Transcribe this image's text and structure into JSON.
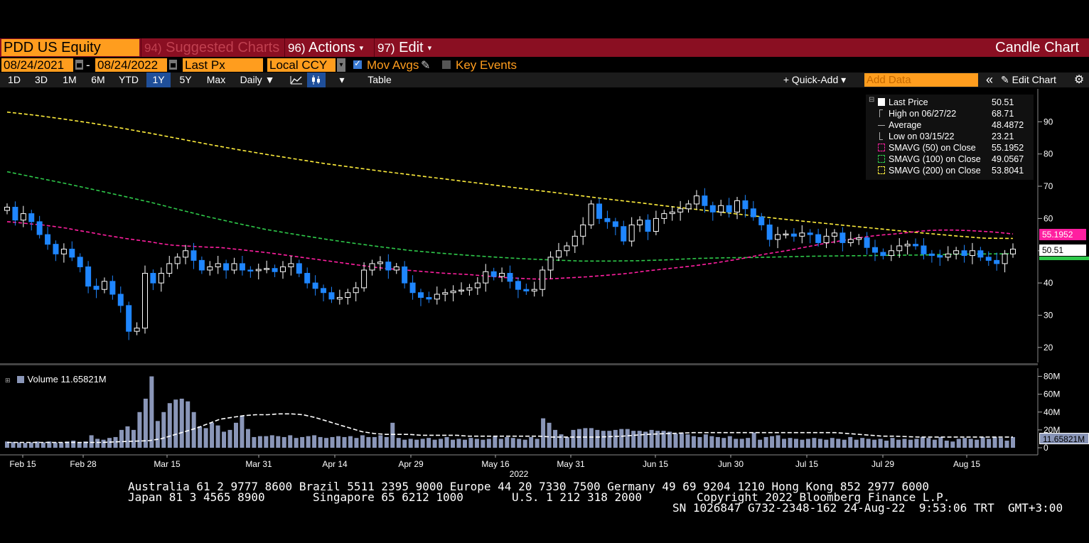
{
  "header": {
    "ticker": "PDD US Equity",
    "suggested": {
      "num": "94)",
      "label": "Suggested Charts"
    },
    "actions": {
      "num": "96)",
      "label": "Actions"
    },
    "edit": {
      "num": "97)",
      "label": "Edit"
    },
    "chart_title": "Candle Chart",
    "caret": "▾"
  },
  "controls": {
    "start_date": "08/24/2021",
    "date_sep": "-",
    "end_date": "08/24/2022",
    "field": "Last Px",
    "currency": "Local CCY",
    "mov_avgs_label": "Mov Avgs",
    "mov_avgs_checked": true,
    "key_events_label": "Key Events",
    "key_events_checked": false
  },
  "toolbar": {
    "ranges": [
      "1D",
      "3D",
      "1M",
      "6M",
      "YTD",
      "1Y",
      "5Y",
      "Max"
    ],
    "active_range": "1Y",
    "period": "Daily ▼",
    "table_label": "Table",
    "quick_add_label": "+ Quick-Add ▾",
    "add_data_placeholder": "Add Data",
    "edit_chart_label": "Edit Chart",
    "collapse_glyph": "«",
    "pencil_glyph": "✎",
    "gear_glyph": "⚙"
  },
  "legend": {
    "rows": [
      {
        "label": "Last Price",
        "value": "50.51",
        "marker": "white-square"
      },
      {
        "label": "High on 06/27/22",
        "value": "68.71",
        "marker": "high-tick"
      },
      {
        "label": "Average",
        "value": "48.4872",
        "marker": "avg-line"
      },
      {
        "label": "Low on 03/15/22",
        "value": "23.21",
        "marker": "low-tick"
      },
      {
        "label": "SMAVG (50)  on Close",
        "value": "55.1952",
        "marker": "pink-dash"
      },
      {
        "label": "SMAVG (100)  on Close",
        "value": "49.0567",
        "marker": "green-dash"
      },
      {
        "label": "SMAVG (200)  on Close",
        "value": "53.8041",
        "marker": "yellow-dash"
      }
    ]
  },
  "volume_legend": {
    "label": "Volume",
    "value": "11.65821M"
  },
  "price_tags": {
    "sma50": "55.1952",
    "last": "50.51",
    "vol": "11.65821M"
  },
  "footer": {
    "line1": "Australia 61 2 9777 8600 Brazil 5511 2395 9000 Europe 44 20 7330 7500 Germany 49 69 9204 1210 Hong Kong 852 2977 6000",
    "line2a": "Japan 81 3 4565 8900",
    "line2b": "Singapore 65 6212 1000",
    "line2c": "U.S. 1 212 318 2000",
    "line2d": "Copyright 2022 Bloomberg Finance L.P.",
    "line3": "SN 1026847 G732-2348-162 24-Aug-22  9:53:06 TRT  GMT+3:00"
  },
  "colors": {
    "up": "#ffffff",
    "down": "#1f86ff",
    "sma50": "#ff1fa0",
    "sma100": "#2ec94a",
    "sma200": "#ffee3c",
    "volume": "#8a96b8",
    "header_red": "#8a0f22",
    "accent_orange": "#ff9d1e"
  },
  "chart_data": {
    "type": "candlestick",
    "x_tick_labels": [
      "Feb 15",
      "Feb 28",
      "Mar 15",
      "Mar 31",
      "Apr 14",
      "Apr 29",
      "May 16",
      "May 31",
      "Jun 15",
      "Jun 30",
      "Jul 15",
      "Jul 29",
      "Aug 15"
    ],
    "x_year_label": "2022",
    "y_ticks": [
      20,
      30,
      40,
      50,
      60,
      70,
      80,
      90
    ],
    "ylim": [
      16,
      98
    ],
    "vol_ticks": [
      {
        "label": "0",
        "v": 0
      },
      {
        "label": "20M",
        "v": 20
      },
      {
        "label": "40M",
        "v": 40
      },
      {
        "label": "60M",
        "v": 60
      },
      {
        "label": "80M",
        "v": 80
      }
    ],
    "vol_ylim": [
      0,
      90
    ],
    "close": [
      63.5,
      59.5,
      61.5,
      59,
      55,
      52,
      49,
      50.5,
      48,
      45,
      39,
      38,
      40.5,
      36.5,
      33,
      25,
      26,
      43,
      40,
      43,
      46,
      48,
      50,
      47,
      44,
      45,
      46,
      44,
      46,
      44,
      43.8,
      44.2,
      44.5,
      43.5,
      45,
      46,
      43,
      40,
      38.3,
      37,
      35,
      35.5,
      37,
      38.5,
      44,
      46,
      46.5,
      44,
      45,
      40,
      37,
      35.5,
      35,
      36.5,
      37,
      37.5,
      37.8,
      38.5,
      40,
      43.5,
      42,
      43,
      40.5,
      38,
      37.5,
      38,
      44,
      48,
      50,
      51.5,
      54.5,
      58,
      64.5,
      60,
      59,
      57.5,
      53,
      58,
      59.5,
      56,
      60,
      61.5,
      62,
      63,
      64.5,
      67,
      64,
      62,
      64,
      62,
      65.5,
      63,
      60.5,
      58,
      53.5,
      55,
      55.2,
      54.5,
      55.5,
      55,
      52.5,
      54.5,
      55.5,
      52.5,
      53.5,
      54,
      51,
      49.5,
      48.5,
      50,
      51.5,
      52,
      51.5,
      49,
      48.5,
      48,
      49,
      50,
      48.5,
      50,
      48,
      47,
      46,
      49,
      50.5
    ],
    "sma50": [
      59,
      58.7,
      58.3,
      58,
      57.5,
      57,
      56.3,
      55.7,
      55,
      54.4,
      53.8,
      53.3,
      52.8,
      52.2,
      51.7,
      51.5,
      51.3,
      51.1,
      51,
      50.6,
      50.2,
      49.8,
      49.4,
      48.9,
      48.4,
      47.9,
      47.4,
      46.9,
      46.4,
      45.9,
      45.4,
      44.9,
      44.5,
      44.2,
      43.9,
      43.6,
      43.3,
      43.0,
      42.8,
      42.6,
      42.3,
      42.0,
      41.7,
      41.5,
      41.3,
      41.2,
      41.3,
      41.5,
      41.7,
      41.9,
      42.2,
      42.5,
      42.8,
      43.2,
      43.7,
      44.1,
      44.5,
      44.9,
      45.3,
      45.8,
      46.3,
      46.9,
      47.5,
      48.2,
      48.9,
      49.5,
      50.1,
      50.8,
      51.5,
      52.2,
      52.8,
      53.4,
      54.0,
      54.5,
      54.9,
      55.2,
      55.6,
      56.0,
      56.3,
      56.4,
      56.4,
      56.3,
      56.1,
      55.9,
      55.6,
      55.2
    ],
    "sma100": [
      74.5,
      72.7,
      70.9,
      69,
      67,
      65.0,
      62.7,
      60.5,
      58.5,
      56.6,
      55.1,
      53.7,
      52.4,
      51.2,
      50.1,
      49.3,
      48.6,
      48.0,
      47.5,
      47.1,
      46.8,
      46.8,
      46.9,
      47.2,
      47.6,
      47.8,
      47.9,
      48.1,
      48.3,
      48.4,
      48.5,
      48.6,
      48.7,
      48.9,
      49.0,
      49.06
    ],
    "sma200": [
      93,
      92,
      90.8,
      89.5,
      88,
      86.4,
      84.7,
      83.0,
      81.4,
      79.9,
      78.5,
      77.1,
      75.9,
      74.7,
      73.6,
      72.5,
      71.4,
      70.3,
      69.2,
      68.1,
      67.0,
      65.9,
      64.9,
      63.8,
      62.8,
      61.8,
      60.8,
      59.8,
      58.9,
      58.0,
      57.1,
      56.2,
      55.4,
      54.6,
      53.9,
      53.8
    ],
    "volume": [
      7,
      6.5,
      6,
      5.5,
      6,
      7,
      6,
      7,
      6,
      6,
      7,
      8,
      6,
      7,
      14,
      10,
      9,
      11,
      12,
      20,
      24,
      20,
      40,
      55,
      80,
      30,
      40,
      50,
      54,
      55,
      52,
      40,
      24,
      22,
      28,
      25,
      18,
      20,
      28,
      36,
      21,
      12,
      13,
      13,
      14,
      13,
      12,
      14,
      11,
      12,
      13,
      14,
      12,
      11,
      12,
      13,
      12,
      13,
      11,
      14,
      12,
      12,
      14,
      12,
      28,
      11,
      9,
      10,
      9,
      10,
      11,
      9,
      10,
      12,
      9,
      10,
      9,
      11,
      10,
      9,
      10,
      13,
      10,
      12,
      11,
      10,
      9,
      12,
      10,
      33,
      28,
      20,
      15,
      12,
      20,
      21,
      22,
      22,
      20,
      19,
      19,
      20,
      21,
      21,
      19,
      19,
      18,
      20,
      19,
      19,
      18,
      16,
      17,
      15,
      13,
      12,
      15,
      13,
      12,
      11,
      13,
      10,
      10,
      11,
      17,
      9,
      12,
      13,
      14,
      10,
      11,
      10,
      9,
      10,
      11,
      10,
      9,
      11,
      10,
      9,
      12,
      9,
      11,
      10,
      9,
      10,
      8,
      11,
      9,
      10,
      9,
      10,
      12,
      11,
      9,
      12,
      8,
      7,
      10,
      11,
      10,
      9,
      12,
      10,
      12,
      11,
      8,
      12
    ],
    "vol_avg": [
      6,
      6,
      6,
      6,
      6,
      6,
      6,
      6,
      6,
      6.5,
      7,
      7.5,
      8,
      10,
      14,
      18,
      22,
      27,
      32,
      34,
      36,
      37,
      37,
      38,
      38,
      37,
      34,
      30,
      26,
      22,
      18,
      16,
      15,
      15,
      15,
      14,
      14,
      14,
      14,
      13,
      13,
      13,
      13,
      13,
      13,
      13,
      12,
      12,
      12,
      12,
      12,
      12.5,
      13,
      14,
      15,
      15.5,
      16,
      16.5,
      17,
      17,
      17,
      17,
      17,
      17,
      17,
      17,
      17,
      17,
      17,
      17,
      17,
      16,
      15,
      14,
      13,
      13,
      12.5,
      12,
      12,
      12,
      12,
      12,
      12,
      12,
      12,
      12
    ]
  }
}
